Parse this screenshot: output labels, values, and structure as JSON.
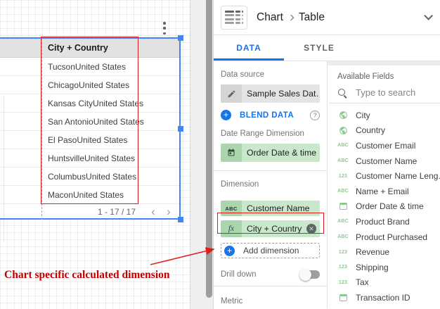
{
  "canvas": {
    "table": {
      "header": "City + Country",
      "rows": [
        "TucsonUnited States",
        "ChicagoUnited States",
        "Kansas CityUnited States",
        "San AntonioUnited States",
        "El PasoUnited States",
        "HuntsvilleUnited States",
        "ColumbusUnited States",
        "MaconUnited States"
      ],
      "pagination": "1 - 17 / 17"
    },
    "annotation_text": "Chart specific calculated dimension"
  },
  "panel": {
    "title": {
      "crumb1": "Chart",
      "crumb2": "Table"
    },
    "tabs": {
      "data": "DATA",
      "style": "STYLE"
    },
    "sections": {
      "data_source_label": "Data source",
      "data_source_name": "Sample Sales Dat…",
      "blend_data": "BLEND DATA",
      "date_range_label": "Date Range Dimension",
      "date_range_value": "Order Date & time",
      "dimension_label": "Dimension",
      "chips": [
        {
          "icon": "ABC",
          "label": "Customer Name"
        },
        {
          "icon": "fx",
          "label": "City + Country"
        }
      ],
      "add_dimension": "Add dimension",
      "drill_down": "Drill down",
      "metric_label": "Metric"
    },
    "fields": {
      "title": "Available Fields",
      "search_placeholder": "Type to search",
      "items": [
        {
          "type": "geo",
          "label": "City"
        },
        {
          "type": "geo",
          "label": "Country"
        },
        {
          "type": "text",
          "label": "Customer Email"
        },
        {
          "type": "text",
          "label": "Customer Name"
        },
        {
          "type": "number",
          "label": "Customer Name Leng…"
        },
        {
          "type": "text",
          "label": "Name + Email"
        },
        {
          "type": "date",
          "label": "Order Date & time"
        },
        {
          "type": "text",
          "label": "Product Brand"
        },
        {
          "type": "text",
          "label": "Product Purchased"
        },
        {
          "type": "number",
          "label": "Revenue"
        },
        {
          "type": "number",
          "label": "Shipping"
        },
        {
          "type": "number",
          "label": "Tax"
        },
        {
          "type": "date",
          "label": "Transaction ID"
        }
      ]
    }
  },
  "colors": {
    "accent_blue": "#1a73e8",
    "selection_blue": "#4285f4",
    "chip_green": "#c9e7ca",
    "chip_gray": "#e4e4e4",
    "field_icon_green": "#8bc98e",
    "annotation_red": "#e01e1e"
  }
}
